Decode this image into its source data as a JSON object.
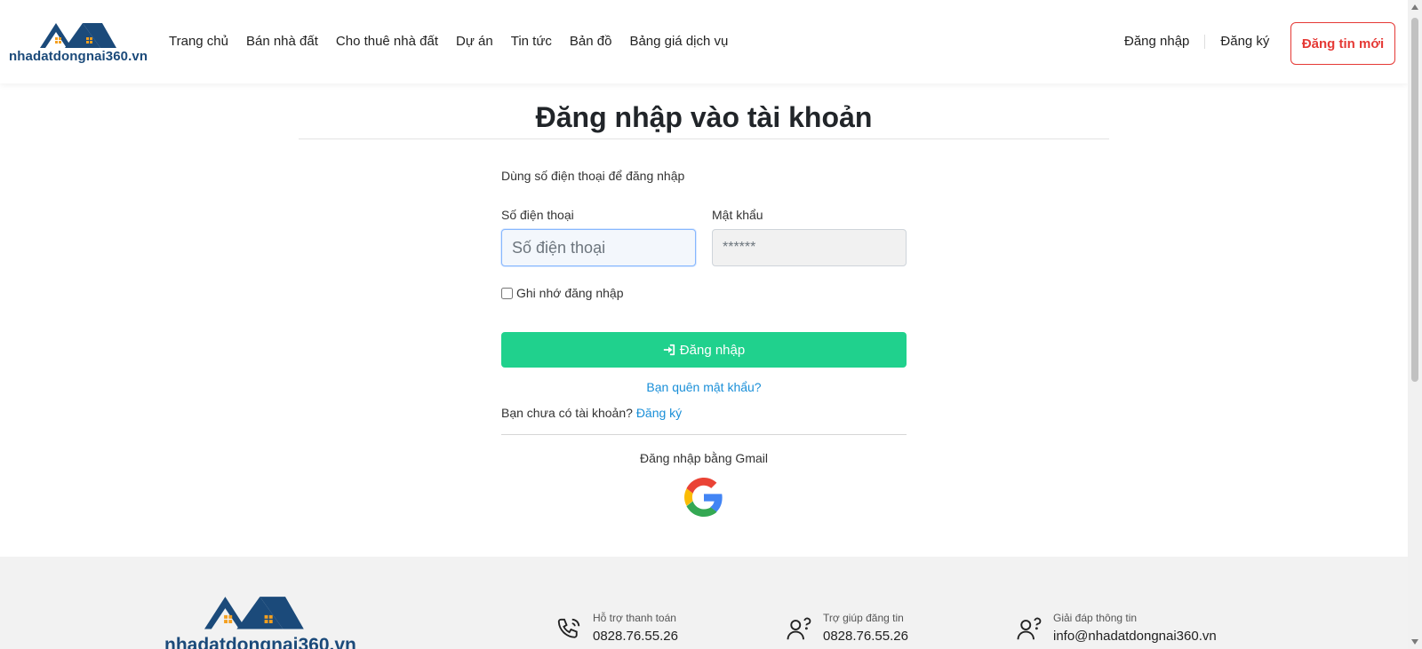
{
  "header": {
    "logo_text": "nhadatdongnai360.vn",
    "nav": [
      {
        "label": "Trang chủ"
      },
      {
        "label": "Bán nhà đất"
      },
      {
        "label": "Cho thuê nhà đất"
      },
      {
        "label": "Dự án"
      },
      {
        "label": "Tin tức"
      },
      {
        "label": "Bản đồ"
      },
      {
        "label": "Bảng giá dịch vụ"
      }
    ],
    "login_label": "Đăng nhập",
    "register_label": "Đăng ký",
    "post_button": "Đăng tin mới"
  },
  "main": {
    "title": "Đăng nhập vào tài khoản",
    "hint": "Dùng số điện thoại để đăng nhập",
    "phone_label": "Số điện thoại",
    "phone_placeholder": "Số điện thoại",
    "password_label": "Mật khẩu",
    "password_placeholder": "******",
    "remember_label": "Ghi nhớ đăng nhập",
    "login_button": "Đăng nhập",
    "forgot_link": "Bạn quên mật khẩu?",
    "no_account_text": "Bạn chưa có tài khoản?",
    "signup_link": "Đăng ký",
    "gmail_text": "Đăng nhập bằng Gmail"
  },
  "footer": {
    "logo_text": "nhadatdongnai360.vn",
    "items": [
      {
        "label": "Hỗ trợ thanh toán",
        "value": "0828.76.55.26",
        "icon": "phone-icon"
      },
      {
        "label": "Trợ giúp đăng tin",
        "value": "0828.76.55.26",
        "icon": "user-help-icon"
      },
      {
        "label": "Giải đáp thông tin",
        "value": "info@nhadatdongnai360.vn",
        "icon": "user-help-icon"
      }
    ]
  },
  "colors": {
    "brand": "#1b4a7a",
    "accent_red": "#e53935",
    "login_green": "#20d18d",
    "link_blue": "#1a8fd8"
  }
}
